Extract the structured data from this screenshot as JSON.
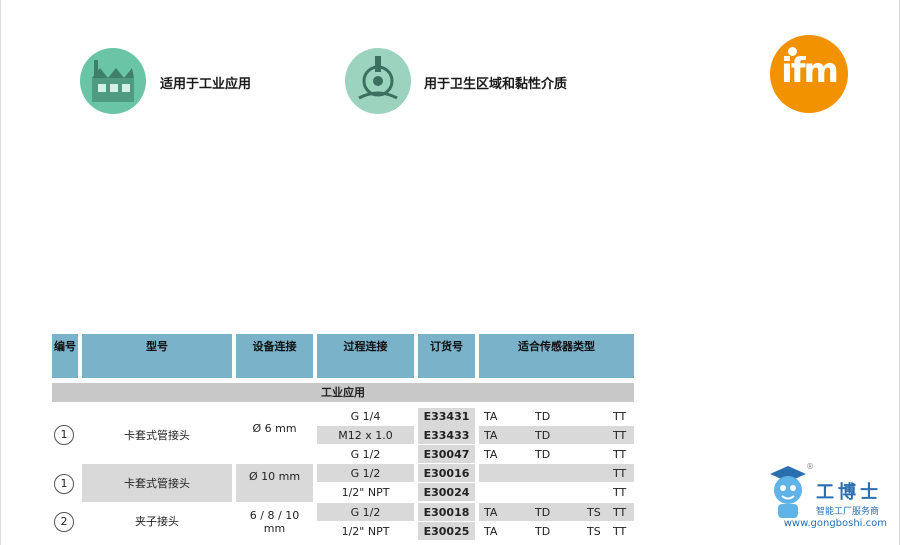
{
  "features": [
    {
      "icon": "factory-icon",
      "label": "适用于工业应用"
    },
    {
      "icon": "hygienic-icon",
      "label": "用于卫生区域和黏性介质"
    }
  ],
  "brand": {
    "logo_text": "ifm",
    "color": "#f39200"
  },
  "table": {
    "headers": [
      "编号",
      "型号",
      "设备连接",
      "过程连接",
      "订货号",
      "适合传感器类型"
    ],
    "section": "工业应用",
    "groups": [
      {
        "num": "1",
        "model": "卡套式管接头",
        "device": "Ø 6 mm",
        "rows": [
          {
            "process": "G 1/4",
            "order": "E33431",
            "ta": "TA",
            "td": "TD",
            "ts": "",
            "tt": "TT"
          },
          {
            "process": "M12 x 1.0",
            "order": "E33433",
            "ta": "TA",
            "td": "TD",
            "ts": "",
            "tt": "TT"
          },
          {
            "process": "G 1/2",
            "order": "E30047",
            "ta": "TA",
            "td": "TD",
            "ts": "",
            "tt": "TT"
          }
        ]
      },
      {
        "num": "1",
        "model": "卡套式管接头",
        "device": "Ø 10 mm",
        "rows": [
          {
            "process": "G 1/2",
            "order": "E30016",
            "ta": "",
            "td": "",
            "ts": "",
            "tt": "TT"
          },
          {
            "process": "1/2\" NPT",
            "order": "E30024",
            "ta": "",
            "td": "",
            "ts": "",
            "tt": "TT"
          }
        ]
      },
      {
        "num": "2",
        "model": "夹子接头",
        "device": "6 / 8 / 10",
        "device2": "mm",
        "rows": [
          {
            "process": "G 1/2",
            "order": "E30018",
            "ta": "TA",
            "td": "TD",
            "ts": "TS",
            "tt": "TT"
          },
          {
            "process": "1/2\" NPT",
            "order": "E30025",
            "ta": "TA",
            "td": "TD",
            "ts": "TS",
            "tt": "TT"
          }
        ]
      }
    ]
  },
  "watermark": {
    "title": "工博士",
    "subtitle": "智能工厂服务商",
    "url": "www.gongboshi.com",
    "mark": "®"
  }
}
